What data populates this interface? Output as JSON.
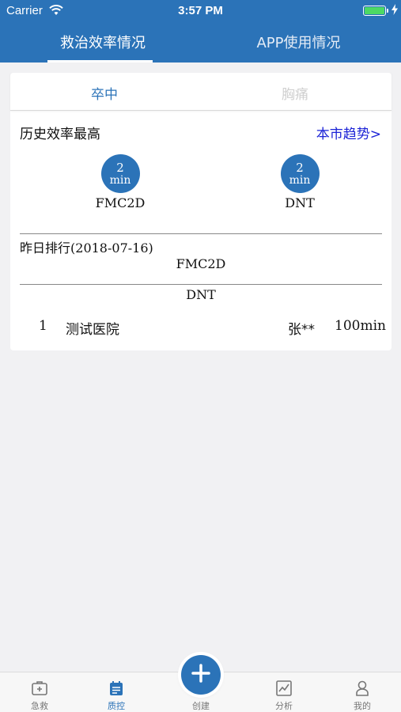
{
  "status_bar": {
    "carrier": "Carrier",
    "time": "3:57 PM"
  },
  "top_tabs": [
    {
      "label": "救治效率情况",
      "active": true
    },
    {
      "label": "APP使用情况",
      "active": false
    }
  ],
  "segment": [
    {
      "label": "卒中",
      "active": true
    },
    {
      "label": "胸痛",
      "active": false
    }
  ],
  "history": {
    "title": "历史效率最高",
    "trend_link": "本市趋势>",
    "metrics": [
      {
        "value": "2",
        "unit": "min",
        "label": "FMC2D"
      },
      {
        "value": "2",
        "unit": "min",
        "label": "DNT"
      }
    ]
  },
  "ranking": {
    "title": "昨日排行",
    "date": "(2018-07-16)",
    "fmc_label": "FMC2D",
    "dnt_label": "DNT",
    "rows": [
      {
        "rank": "1",
        "hospital": "测试医院",
        "doctor": "张**",
        "time": "100min"
      }
    ]
  },
  "tab_bar": {
    "items": [
      {
        "label": "急救",
        "icon": "first-aid-kit-icon"
      },
      {
        "label": "质控",
        "icon": "calendar-icon",
        "active": true
      },
      {
        "label": "创建",
        "icon": "plus-icon"
      },
      {
        "label": "分析",
        "icon": "chart-icon"
      },
      {
        "label": "我的",
        "icon": "person-icon"
      }
    ]
  },
  "colors": {
    "primary": "#2b73b8",
    "link": "#1b22d6",
    "background": "#f1f1f3"
  }
}
